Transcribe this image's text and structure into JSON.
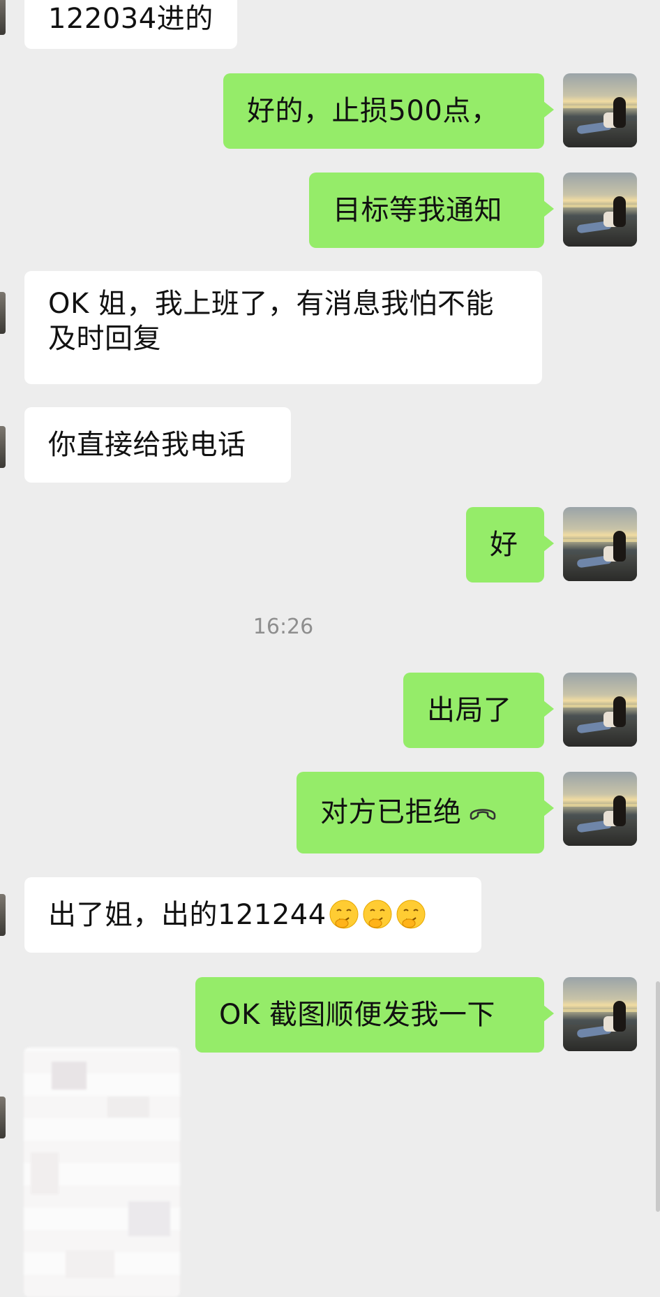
{
  "conversation": {
    "messages": [
      {
        "id": "m0",
        "direction": "incoming",
        "text": "122034进的"
      },
      {
        "id": "m1",
        "direction": "outgoing",
        "text": "好的，止损500点，"
      },
      {
        "id": "m2",
        "direction": "outgoing",
        "text": "目标等我通知"
      },
      {
        "id": "m3",
        "direction": "incoming",
        "text": "OK 姐，我上班了，有消息我怕不能及时回复"
      },
      {
        "id": "m4",
        "direction": "incoming",
        "text": "你直接给我电话"
      },
      {
        "id": "m5",
        "direction": "outgoing",
        "text": "好"
      },
      {
        "id": "m6",
        "direction": "outgoing",
        "text": "出局了"
      },
      {
        "id": "m7",
        "direction": "outgoing",
        "text": "对方已拒绝",
        "icon": "phone-hangup-icon"
      },
      {
        "id": "m8",
        "direction": "incoming",
        "text": "出了姐，出的121244",
        "emoji": [
          "thinking-face-emoji",
          "thinking-face-emoji",
          "thinking-face-emoji"
        ]
      },
      {
        "id": "m9",
        "direction": "outgoing",
        "text": "OK 截图顺便发我一下"
      },
      {
        "id": "m10",
        "direction": "incoming",
        "type": "image",
        "note": "blurred-image"
      }
    ],
    "timestamp": "16:26"
  },
  "colors": {
    "background": "#ededed",
    "incoming_bubble": "#ffffff",
    "outgoing_bubble": "#95ec69",
    "timestamp_text": "#8e8e8e"
  }
}
